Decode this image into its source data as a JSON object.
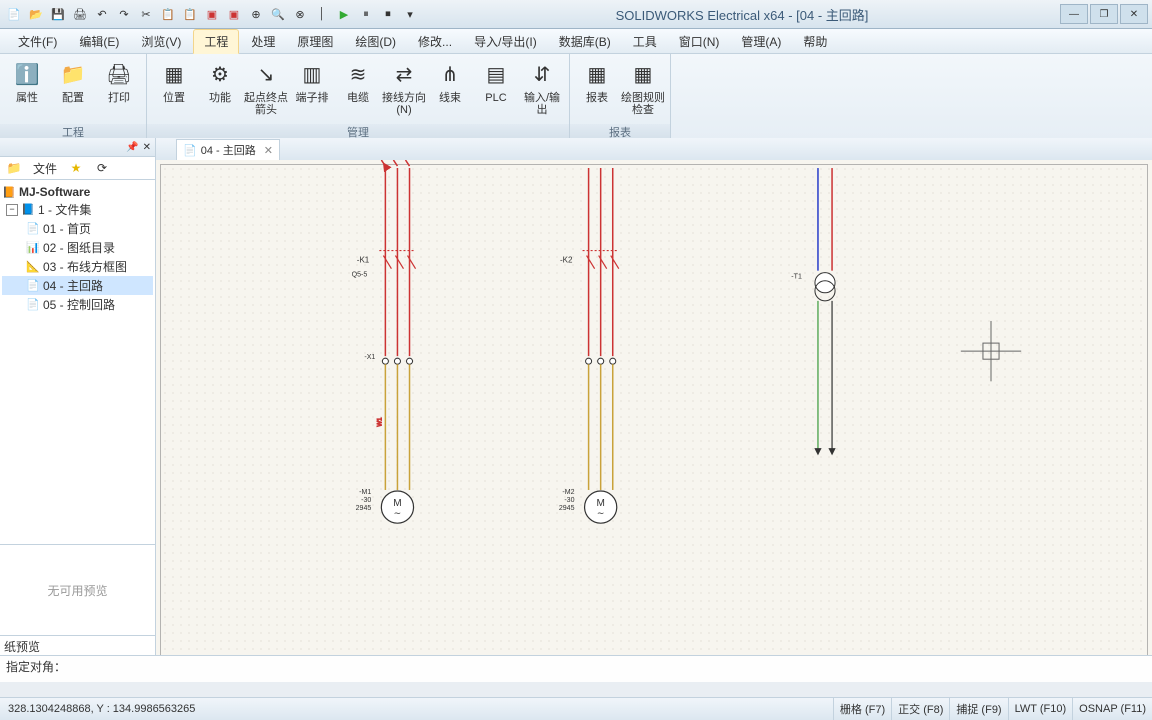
{
  "app": {
    "title": "SOLIDWORKS Electrical x64 - [04 - 主回路]"
  },
  "menus": [
    "文件(F)",
    "编辑(E)",
    "浏览(V)",
    "工程",
    "处理",
    "原理图",
    "绘图(D)",
    "修改...",
    "导入/导出(I)",
    "数据库(B)",
    "工具",
    "窗口(N)",
    "管理(A)",
    "帮助"
  ],
  "ribbon": {
    "groups": [
      {
        "label": "工程",
        "tools": [
          {
            "label": "属性",
            "icon": "ℹ️"
          },
          {
            "label": "配置",
            "icon": "📁"
          },
          {
            "label": "打印",
            "icon": "🖨"
          }
        ]
      },
      {
        "label": "管理",
        "tools": [
          {
            "label": "位置",
            "icon": "▦"
          },
          {
            "label": "功能",
            "icon": "⚙"
          },
          {
            "label": "起点终点箭头",
            "icon": "↘"
          },
          {
            "label": "端子排",
            "icon": "▥"
          },
          {
            "label": "电缆",
            "icon": "≋"
          },
          {
            "label": "接线方向(N)",
            "icon": "⇄"
          },
          {
            "label": "线束",
            "icon": "⋔"
          },
          {
            "label": "PLC",
            "icon": "▤"
          },
          {
            "label": "输入/输出",
            "icon": "⇵"
          }
        ]
      },
      {
        "label": "报表",
        "tools": [
          {
            "label": "报表",
            "icon": "▦"
          },
          {
            "label": "绘图规则检查",
            "icon": "▦"
          }
        ]
      }
    ]
  },
  "sidepanel": {
    "root": "MJ-Software",
    "folder": "1 - 文件集",
    "items": [
      {
        "icon": "📄",
        "label": "01 - 首页"
      },
      {
        "icon": "📊",
        "label": "02 - 图纸目录"
      },
      {
        "icon": "📐",
        "label": "03 - 布线方框图"
      },
      {
        "icon": "📄",
        "label": "04 - 主回路",
        "sel": true
      },
      {
        "icon": "📄",
        "label": "05 - 控制回路"
      }
    ],
    "preview_text": "无可用预览",
    "preview_panel_label": "纸预览"
  },
  "tab": {
    "label": "04 - 主回路"
  },
  "cmd": "指定对角：",
  "status": {
    "coord": "328.1304248868, Y : 134.9986563265",
    "buttons": [
      "栅格 (F7)",
      "正交 (F8)",
      "捕捉 (F9)",
      "LWT (F10)",
      "OSNAP (F11)"
    ]
  },
  "schematic": {
    "refs": {
      "k1": "-K1",
      "k2": "-K2",
      "t1": "-T1",
      "x1": "-X1",
      "m1": "-M1",
      "m2": "-M2",
      "q": "Q5-5",
      "spec1": "-30",
      "spec2": "2945"
    }
  }
}
